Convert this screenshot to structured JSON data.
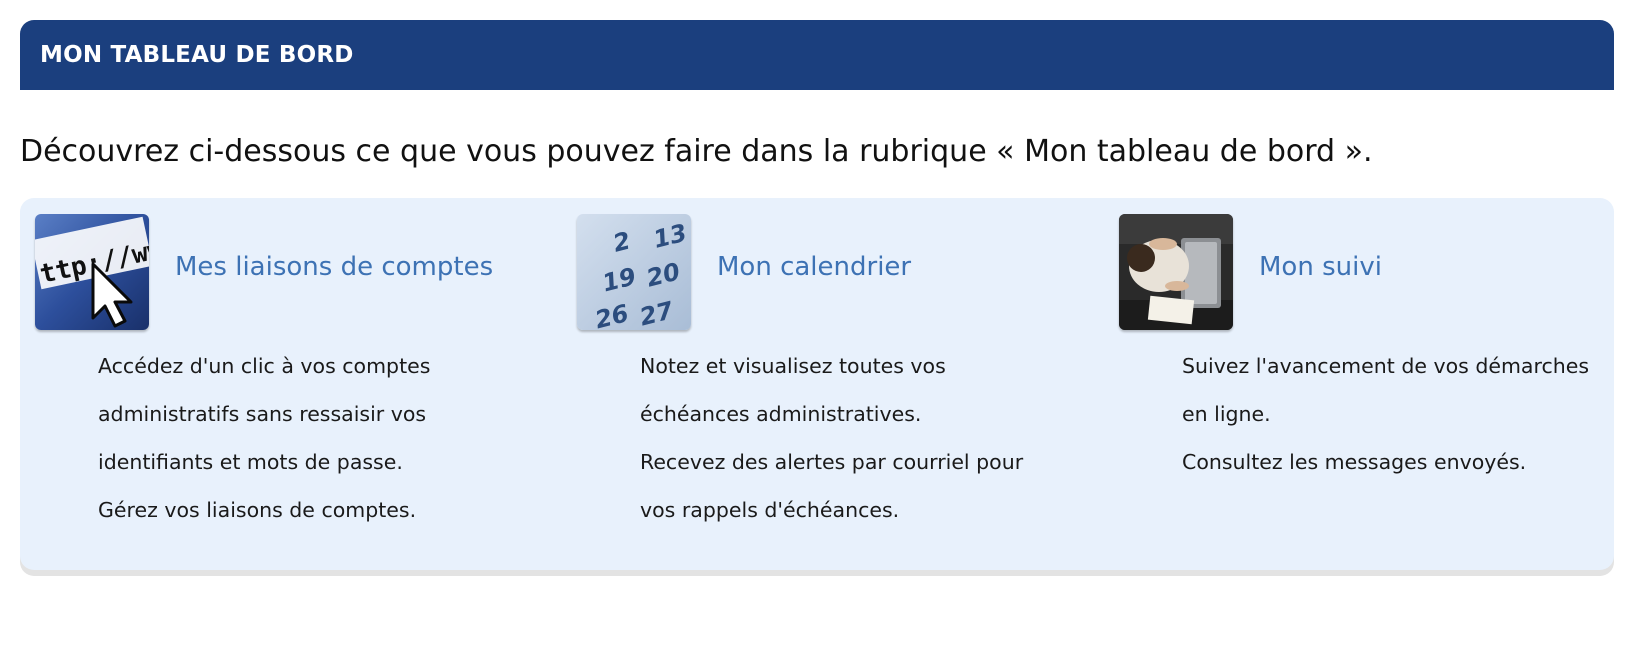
{
  "header": {
    "title": "MON TABLEAU DE BORD"
  },
  "intro": "Découvrez ci-dessous ce que vous pouvez faire dans la rubrique « Mon tableau de bord ».",
  "cards": [
    {
      "title": "Mes liaisons de comptes",
      "icon": "browser-url-cursor-icon",
      "lines": [
        "Accédez d'un clic à vos comptes",
        "administratifs sans ressaisir vos",
        "identifiants et mots de passe.",
        "Gérez vos liaisons de comptes."
      ]
    },
    {
      "title": "Mon calendrier",
      "icon": "calendar-icon",
      "thumb_text": [
        "2",
        "13",
        "19",
        "20",
        "26",
        "27"
      ],
      "lines": [
        "Notez et visualisez toutes vos",
        "échéances administratives.",
        "Recevez des alertes par courriel pour",
        "vos rappels d'échéances."
      ]
    },
    {
      "title": "Mon suivi",
      "icon": "person-at-laptop-icon",
      "lines": [
        "Suivez l'avancement de vos démarches",
        "en ligne.",
        "Consultez les messages envoyés."
      ]
    }
  ],
  "colors": {
    "header_bg": "#1b3f7e",
    "panel_bg": "#e8f1fc",
    "link": "#3d72b4"
  }
}
